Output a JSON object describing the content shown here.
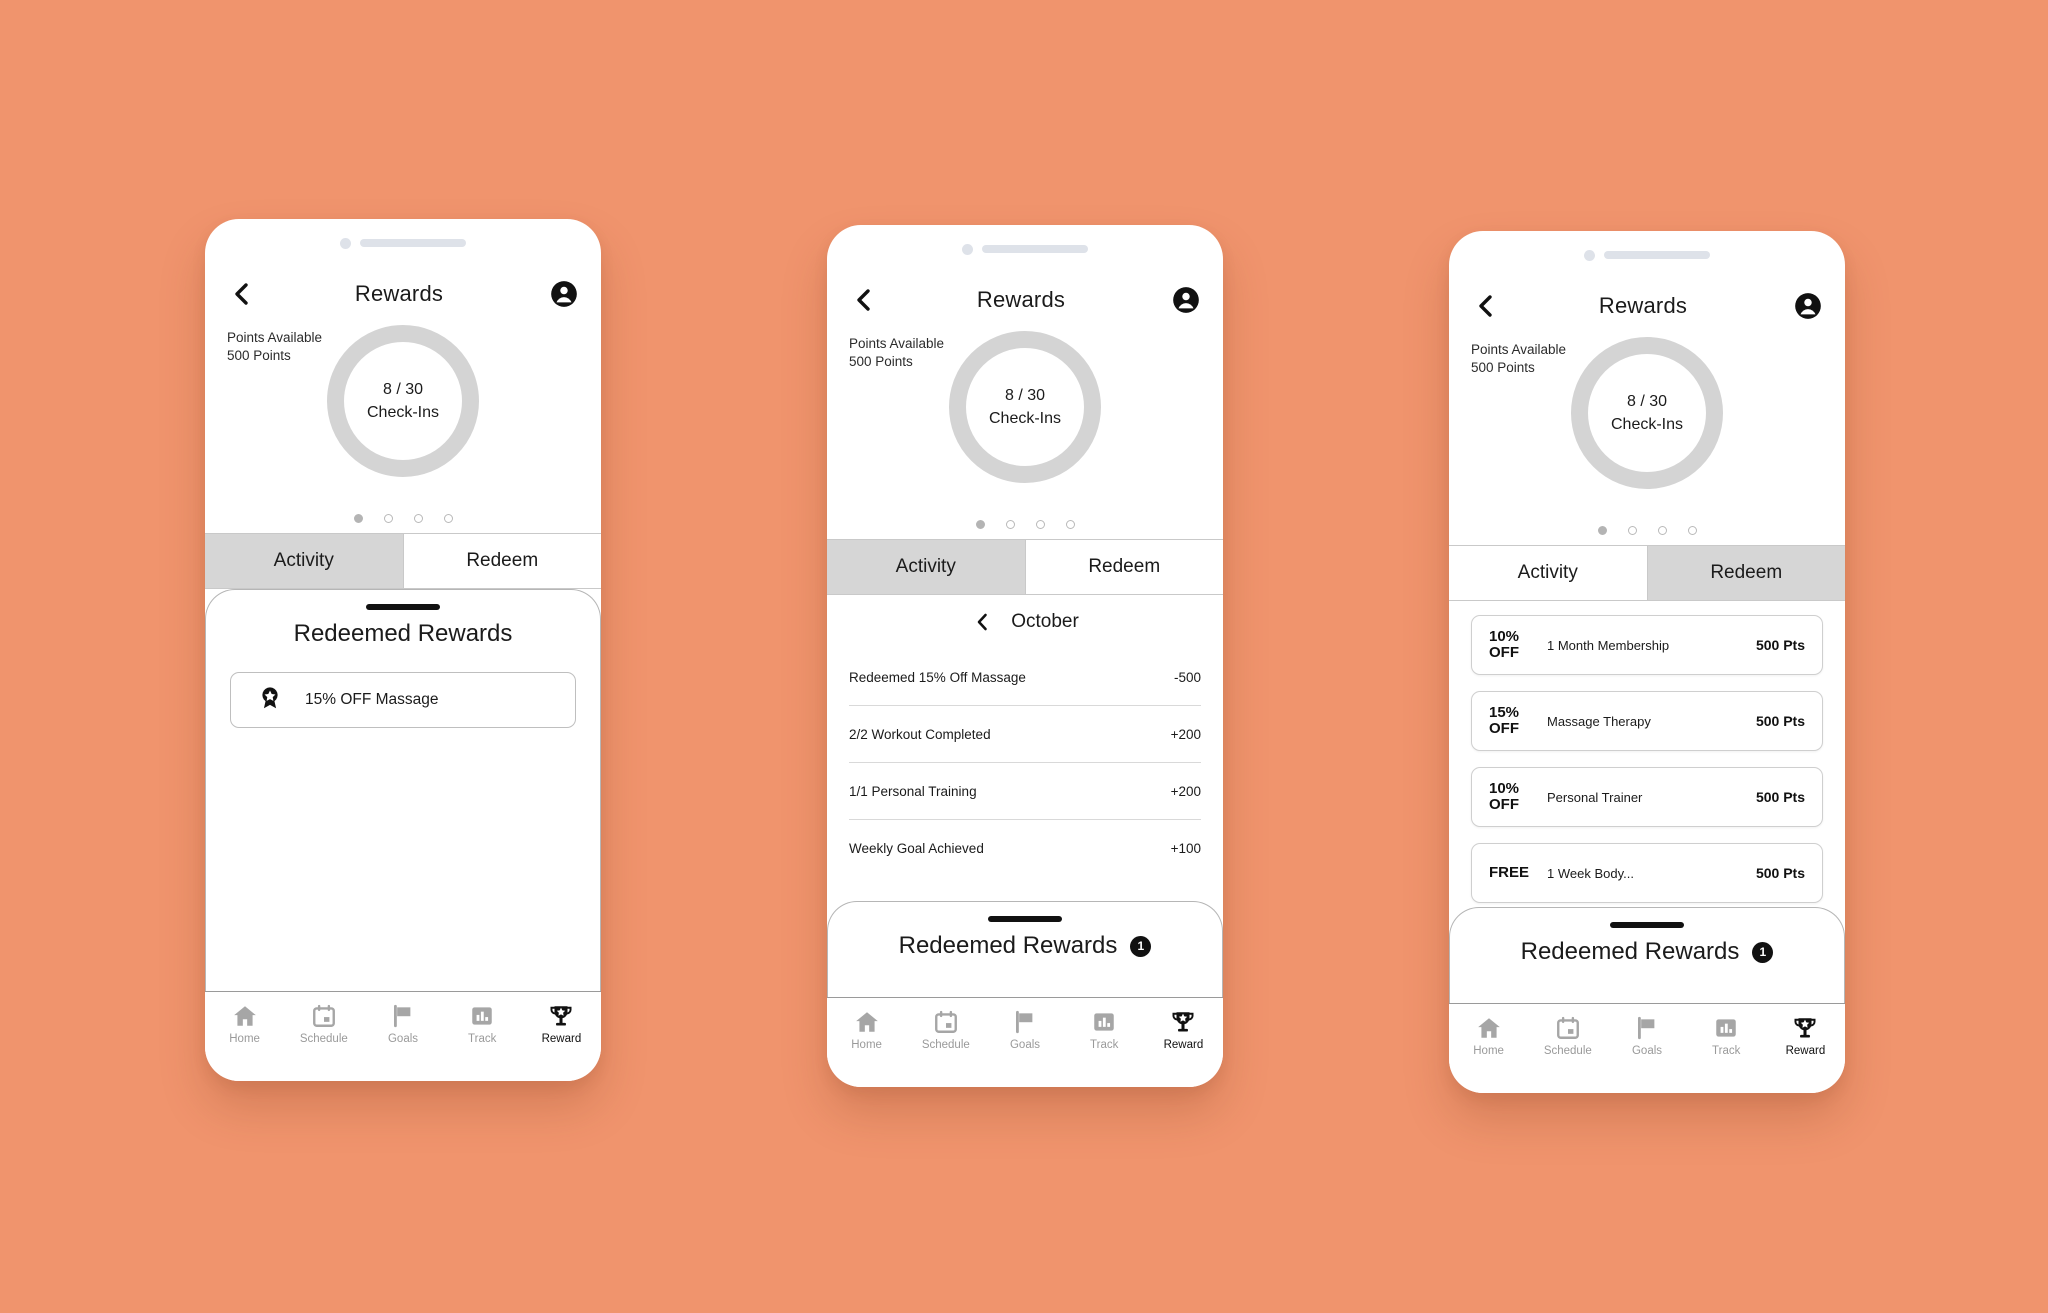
{
  "theme": {
    "background": "#F0946D",
    "ring_color": "#d4d4d4",
    "tab_active_bg": "#d6d6d6",
    "accent_black": "#111111",
    "muted_gray": "#9a9a9a"
  },
  "header": {
    "title": "Rewards",
    "back_icon": "chevron-left-icon",
    "profile_icon": "account-circle-icon"
  },
  "points": {
    "available_label": "Points Available",
    "amount": "500 Points",
    "ring_value": "8 / 30",
    "ring_unit": "Check-Ins"
  },
  "carousel": {
    "total": 4,
    "active_index": 0
  },
  "tabs": [
    {
      "label": "Activity"
    },
    {
      "label": "Redeem"
    }
  ],
  "screens": [
    {
      "id": "screen-activity-expanded",
      "active_tab": 0,
      "sheet": {
        "state": "expanded",
        "title": "Redeemed Rewards",
        "badge": "",
        "items": [
          {
            "icon": "award-badge-icon",
            "label": "15% OFF Massage"
          }
        ]
      }
    },
    {
      "id": "screen-activity-list",
      "active_tab": 0,
      "month": {
        "back_icon": "chevron-left-icon",
        "name": "October"
      },
      "activity": [
        {
          "label": "Redeemed 15% Off Massage",
          "amount": "-500"
        },
        {
          "label": "2/2 Workout Completed",
          "amount": "+200"
        },
        {
          "label": "1/1 Personal Training",
          "amount": "+200"
        },
        {
          "label": "Weekly Goal Achieved",
          "amount": "+100"
        }
      ],
      "sheet": {
        "state": "collapsed",
        "title": "Redeemed Rewards",
        "badge": "1"
      }
    },
    {
      "id": "screen-redeem",
      "active_tab": 1,
      "redeem": [
        {
          "discount_pct": "10%",
          "discount_word": "OFF",
          "name": "1 Month Membership",
          "points": "500 Pts"
        },
        {
          "discount_pct": "15%",
          "discount_word": "OFF",
          "name": "Massage Therapy",
          "points": "500 Pts"
        },
        {
          "discount_pct": "10%",
          "discount_word": "OFF",
          "name": "Personal Trainer",
          "points": "500 Pts"
        },
        {
          "discount_pct": "FREE",
          "discount_word": "",
          "name": "1 Week Body...",
          "points": "500 Pts"
        }
      ],
      "sheet": {
        "state": "collapsed",
        "title": "Redeemed Rewards",
        "badge": "1"
      }
    }
  ],
  "bottom_nav": {
    "items": [
      {
        "label": "Home",
        "icon": "home-icon"
      },
      {
        "label": "Schedule",
        "icon": "calendar-icon"
      },
      {
        "label": "Goals",
        "icon": "flag-icon"
      },
      {
        "label": "Track",
        "icon": "bar-chart-icon"
      },
      {
        "label": "Reward",
        "icon": "trophy-star-icon"
      }
    ],
    "active_index": 4
  }
}
